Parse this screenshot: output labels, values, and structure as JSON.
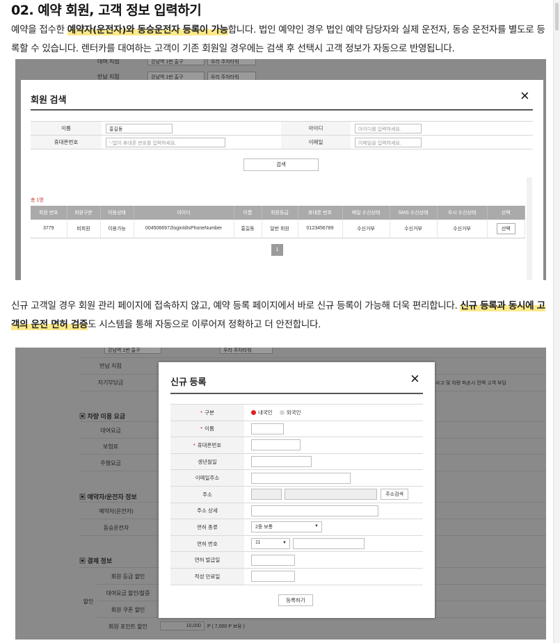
{
  "section": {
    "title": "02. 예약 회원, 고객 정보 입력하기",
    "para1": {
      "t1": "예약을 접수한 ",
      "h1": "예약자(운전자)와 동승운전자 등록이 가능",
      "t2": "합니다. 법인 예약인 경우 법인 예약 담당자와 실제 운전자, 동승 운전자를 별도로 등록할 수 있습니다. 렌터카를 대여하는 고객이 기존 회원일 경우에는 검색 후 선택시 고객 정보가 자동으로 반영됩니다."
    },
    "para2": {
      "t1": "신규 고객일 경우 회원 관리 페이지에 접속하지 않고, 예약 등록 페이지에서 바로 신규 등록이 가능해 더욱 편리합니다. ",
      "h1": "신규 등록과 동시에 고객의 운전 면허 검증",
      "t2": "도 시스템을 통해 자동으로 이루어져 정확하고 더 안전합니다."
    }
  },
  "shot1": {
    "bg": {
      "row1_label": "대여 지점",
      "row1_sel1": "강남역 1번 출구",
      "row1_sel2": "우리 주차타워",
      "row2_label": "반납 지점",
      "row2_sel1": "강남역 1번 출구",
      "row2_sel2": "우리 주차타워"
    },
    "modal": {
      "title": "회원 검색",
      "close": "×",
      "form": {
        "name_label": "이름",
        "name_value": "홍길동",
        "id_label": "아이디",
        "id_placeholder": "아이디를 입력하세요.",
        "phone_label": "휴대폰번호",
        "phone_placeholder": "'-'없이 휴대폰 번호를 입력하세요.",
        "email_label": "이메일",
        "email_placeholder": "이메일을 입력하세요."
      },
      "search_button": "검색",
      "total": "총 1명",
      "columns": [
        "회원 번호",
        "회원구분",
        "이용상태",
        "아이디",
        "이름",
        "회원등급",
        "휴대폰 번호",
        "메일 수신상태",
        "SMS 수신상태",
        "우시 수신상태",
        "선택"
      ],
      "row": [
        "3779",
        "비회원",
        "이용가능",
        "0045066972loginIdIsPhoneNumber",
        "홍길동",
        "일반 회원",
        "0123456789",
        "수신거부",
        "수신거부",
        "수신거부"
      ],
      "select_label": "선택",
      "page": "1"
    }
  },
  "shot2": {
    "bg": {
      "row1_sel1": "강남역 1번 출구",
      "row1_sel2": "우리 주차타워",
      "label_return": "반납 지점",
      "label_deductible": "자기부담금",
      "deductible_note": "사고 및 차량 파손시 전액 고객 부담",
      "head_usage": "▣ 차량 이용 요금",
      "label_rental_fee": "대여요금",
      "label_insurance": "보험료",
      "label_driving_fee": "주행요금",
      "head_driver": "▣ 예약자/운전자 정보",
      "label_booker": "예약자(운전자)",
      "label_co_driver": "동승운전자",
      "head_payment": "▣ 결제 정보",
      "label_discount": "할인",
      "label_member_discount": "회원 등급 할인",
      "label_rental_discount": "대여요금 할인/할증",
      "label_coupon": "회원 쿠폰 할인",
      "label_points": "회원 포인트 할인",
      "points_value": "10,000",
      "points_note": "P ( 7,000 P 보유 )"
    },
    "modal": {
      "title": "신규 등록",
      "close": "×",
      "fields": {
        "type_label": "구분",
        "type_opt1": "내국인",
        "type_opt2": "외국인",
        "name_label": "이름",
        "phone_label": "휴대폰번호",
        "birth_label": "생년월일",
        "email_label": "이메일주소",
        "address_label": "주소",
        "address_button": "주소검색",
        "address_detail_label": "주소 상세",
        "license_type_label": "면허 종류",
        "license_type_value": "2종 보통",
        "license_no_label": "면허 번호",
        "license_no_value": "11",
        "license_issue_label": "면허 발급일",
        "aptitude_label": "적성 만료일"
      },
      "required_mark": "*",
      "caret": "▼",
      "register_button": "등록하기"
    }
  }
}
